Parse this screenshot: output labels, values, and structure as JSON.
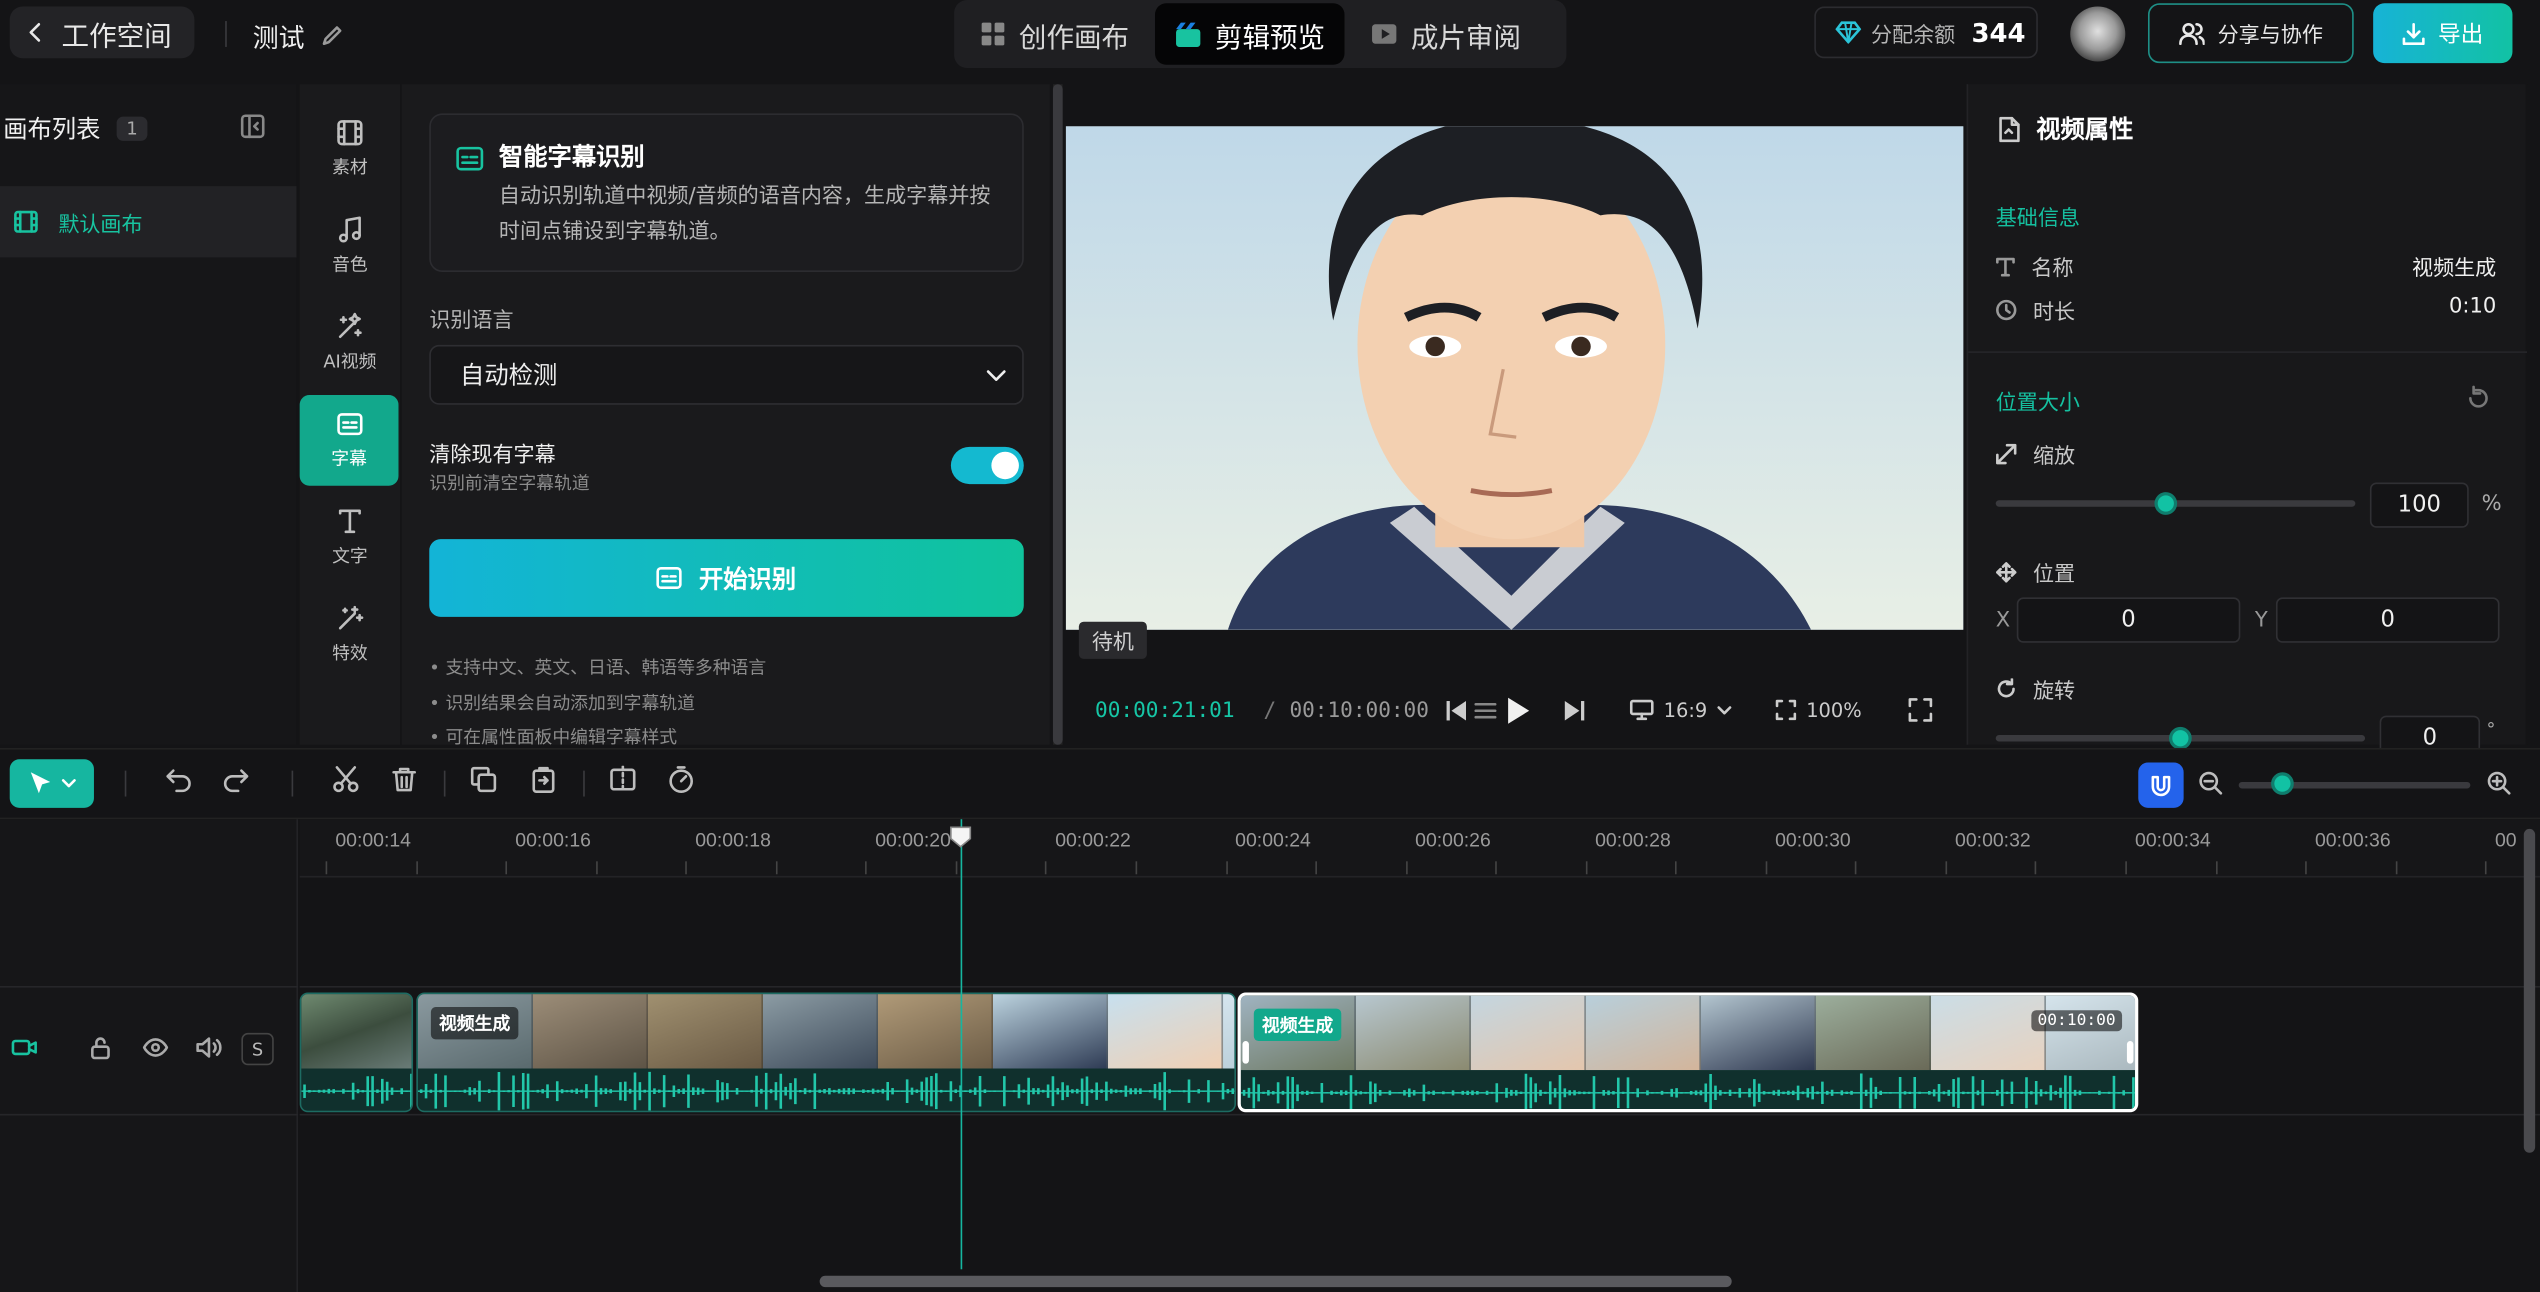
{
  "topbar": {
    "back_label": "工作空间",
    "project_name": "测试",
    "modes": [
      {
        "label": "创作画布",
        "icon": "grid-icon",
        "active": false
      },
      {
        "label": "剪辑预览",
        "icon": "clapper-icon",
        "active": true
      },
      {
        "label": "成片审阅",
        "icon": "film-icon",
        "active": false
      }
    ],
    "quota_label": "分配余额",
    "quota_value": "344",
    "share_label": "分享与协作",
    "export_label": "导出"
  },
  "canvas_list": {
    "title": "画布列表",
    "count": "1",
    "items": [
      "默认画布"
    ]
  },
  "rail": [
    {
      "label": "素材",
      "icon": "film-strip-icon",
      "active": false
    },
    {
      "label": "音色",
      "icon": "music-note-icon",
      "active": false
    },
    {
      "label": "AI视频",
      "icon": "magic-wand-icon",
      "active": false
    },
    {
      "label": "字幕",
      "icon": "subtitle-icon",
      "active": true
    },
    {
      "label": "文字",
      "icon": "text-icon",
      "active": false
    },
    {
      "label": "特效",
      "icon": "sparkle-wand-icon",
      "active": false
    }
  ],
  "subtitle_panel": {
    "card_title": "智能字幕识别",
    "card_desc": "自动识别轨道中视频/音频的语音内容，生成字幕并按时间点铺设到字幕轨道。",
    "language_label": "识别语言",
    "language_value": "自动检测",
    "clear_label": "清除现有字幕",
    "clear_hint": "识别前清空字幕轨道",
    "clear_enabled": true,
    "start_label": "开始识别",
    "tips": [
      "• 支持中文、英文、日语、韩语等多种语言",
      "• 识别结果会自动添加到字幕轨道",
      "• 可在属性面板中编辑字幕样式"
    ]
  },
  "preview": {
    "status": "待机",
    "current_time": "00:00:21:01",
    "separator": "/",
    "total_time": "00:10:00:00",
    "aspect": "16:9",
    "zoom": "100%"
  },
  "properties": {
    "title": "视频属性",
    "basic_section": "基础信息",
    "name_label": "名称",
    "name_value": "视频生成",
    "duration_label": "时长",
    "duration_value": "0:10",
    "position_section": "位置大小",
    "scale_label": "缩放",
    "scale_value": "100",
    "scale_unit": "%",
    "scale_level": 0.5,
    "position_label": "位置",
    "x_label": "X",
    "x_value": "0",
    "y_label": "Y",
    "y_value": "0",
    "rotate_label": "旋转",
    "rotate_value": "0",
    "rotate_unit": "°",
    "rotate_level": 0.5
  },
  "timeline": {
    "ruler": [
      "00:00:14",
      "00:00:16",
      "00:00:18",
      "00:00:20",
      "00:00:22",
      "00:00:24",
      "00:00:26",
      "00:00:28",
      "00:00:30",
      "00:00:32",
      "00:00:34",
      "00:00:36",
      "00"
    ],
    "clips": [
      {
        "label": "",
        "duration": ""
      },
      {
        "label": "视频生成",
        "duration": ""
      },
      {
        "label": "视频生成",
        "duration": "00:10:00"
      }
    ],
    "solo_label": "S",
    "zoom_level": 0.18
  }
}
